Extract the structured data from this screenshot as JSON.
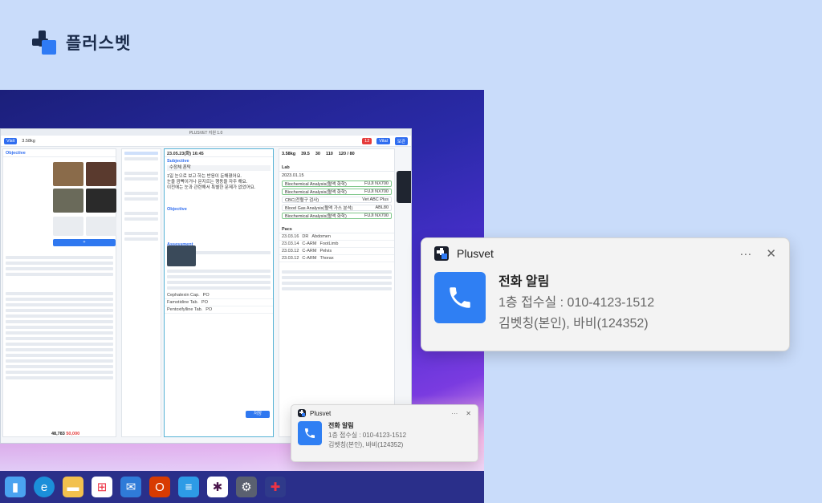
{
  "brand": {
    "name": "플러스벳"
  },
  "app": {
    "title": "PLUSVET 지원 1.0",
    "weight": "3.58kg",
    "objective": "Objective",
    "subjective_date": "23.05.23(화) 16:45",
    "subjective_label": "Subjective",
    "subjective_note": "수정체 혼탁",
    "subjective_text": [
      "1일 눈으로 보고 하는 반응이 둔해졌어요.",
      "눈을 깜빡이거나 문지르는 행동을 자주 해요.",
      "이전에는 눈과 관련해서 특별한 문제가 없었어요."
    ],
    "assessment": "Assessment",
    "plan": "Plan",
    "lab_title": "Lab",
    "lab_date": "2023.01.15",
    "lab_items": [
      {
        "name": "Biochemical Analysis(혈액 화학)",
        "code": "FUJI NX700"
      },
      {
        "name": "Biochemical Analysis(혈액 화학)",
        "code": "FUJI NX700"
      },
      {
        "name": "CBC(전혈구 검사)",
        "code": "Vet ABC Plus"
      },
      {
        "name": "Blood Gas Analysis(혈액 가스 분석)",
        "code": "ABL80"
      },
      {
        "name": "Biochemical Analysis(혈액 화학)",
        "code": "FUJI NX700"
      }
    ],
    "vitals": [
      "3.58kg",
      "39.5",
      "30",
      "110",
      "120 / 80"
    ],
    "pacs_title": "Pacs",
    "pacs_rows": [
      {
        "date": "23.03.16",
        "mod": "DR",
        "part": "Abdomen"
      },
      {
        "date": "23.03.14",
        "mod": "C-ARM",
        "part": "FootLimb"
      },
      {
        "date": "23.03.12",
        "mod": "C-ARM",
        "part": "Pelvis"
      },
      {
        "date": "23.03.12",
        "mod": "C-ARM",
        "part": "Thorax"
      }
    ],
    "rx_rows": [
      {
        "name": "Cephalexin Cap.",
        "route": "PO"
      },
      {
        "name": "Famotidine Tab.",
        "route": "PO"
      },
      {
        "name": "Pentoxifylline Tab.",
        "route": "PO"
      }
    ],
    "save_button": "저장",
    "total": "48,783",
    "total_red": "50,000"
  },
  "toast_large": {
    "app_name": "Plusvet",
    "more": "···",
    "close": "✕",
    "title": "전화 알림",
    "line1": "1층 접수실 : 010-4123-1512",
    "line2": "김벳칭(본인), 바비(124352)"
  },
  "toast_small": {
    "app_name": "Plusvet",
    "more": "···",
    "close": "✕",
    "title": "전화 알림",
    "line1": "1층 접수실 : 010-4123-1512",
    "line2": "김벳칭(본인), 바비(124352)"
  },
  "taskbar": {
    "icons": [
      "widgets-icon",
      "edge-icon",
      "files-icon",
      "store-icon",
      "mail-icon",
      "office-icon",
      "notepad-icon",
      "slack-icon",
      "settings-icon",
      "plusvet-icon"
    ]
  },
  "colors": {
    "accent": "#2f7ff3",
    "brand_dark": "#1a2b4a",
    "toast_bg": "#f3f3f3"
  }
}
